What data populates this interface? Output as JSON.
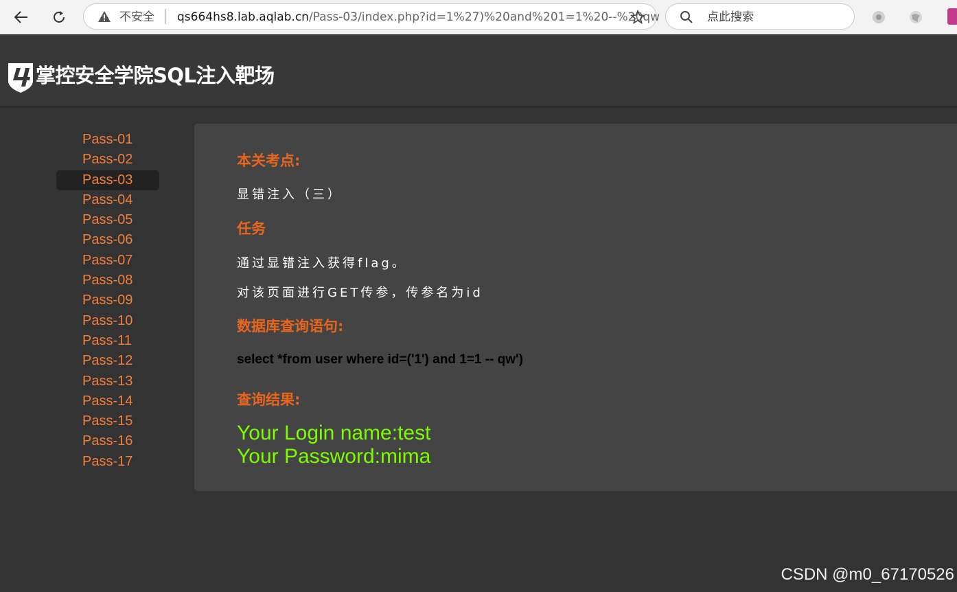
{
  "browser": {
    "insecure_label": "不安全",
    "url_host": "qs664hs8.lab.aqlab.cn",
    "url_path": "/Pass-03/index.php?id=1%27)%20and%201=1%20--%20qw",
    "search_placeholder": "点此搜索"
  },
  "site": {
    "logo_text": "掌控安全学院SQL注入靶场"
  },
  "sidebar": {
    "active_index": 2,
    "items": [
      {
        "label": "Pass-01"
      },
      {
        "label": "Pass-02"
      },
      {
        "label": "Pass-03"
      },
      {
        "label": "Pass-04"
      },
      {
        "label": "Pass-05"
      },
      {
        "label": "Pass-06"
      },
      {
        "label": "Pass-07"
      },
      {
        "label": "Pass-08"
      },
      {
        "label": "Pass-09"
      },
      {
        "label": "Pass-10"
      },
      {
        "label": "Pass-11"
      },
      {
        "label": "Pass-12"
      },
      {
        "label": "Pass-13"
      },
      {
        "label": "Pass-14"
      },
      {
        "label": "Pass-15"
      },
      {
        "label": "Pass-16"
      },
      {
        "label": "Pass-17"
      }
    ]
  },
  "content": {
    "exam_heading": "本关考点:",
    "exam_text": "显错注入（三）",
    "task_heading": "任务",
    "task_line1": "通过显错注入获得flag。",
    "task_line2": "对该页面进行GET传参，传参名为id",
    "query_heading": "数据库查询语句:",
    "query_text": "select *from user where id=('1') and 1=1 -- qw')",
    "result_heading": "查询结果:",
    "result_line1": "Your Login name:test",
    "result_line2": "Your Password:mima"
  },
  "watermark": "CSDN @m0_67170526",
  "colors": {
    "accent_orange": "#e8651d",
    "link_orange": "#f07f3c",
    "result_green": "#7cfc00",
    "page_bg": "#333333",
    "panel_bg": "#444444"
  },
  "icons": {
    "back": "arrow-left-icon",
    "reload": "reload-icon",
    "warning": "warning-triangle-icon",
    "favorite": "star-icon",
    "search": "search-icon"
  }
}
